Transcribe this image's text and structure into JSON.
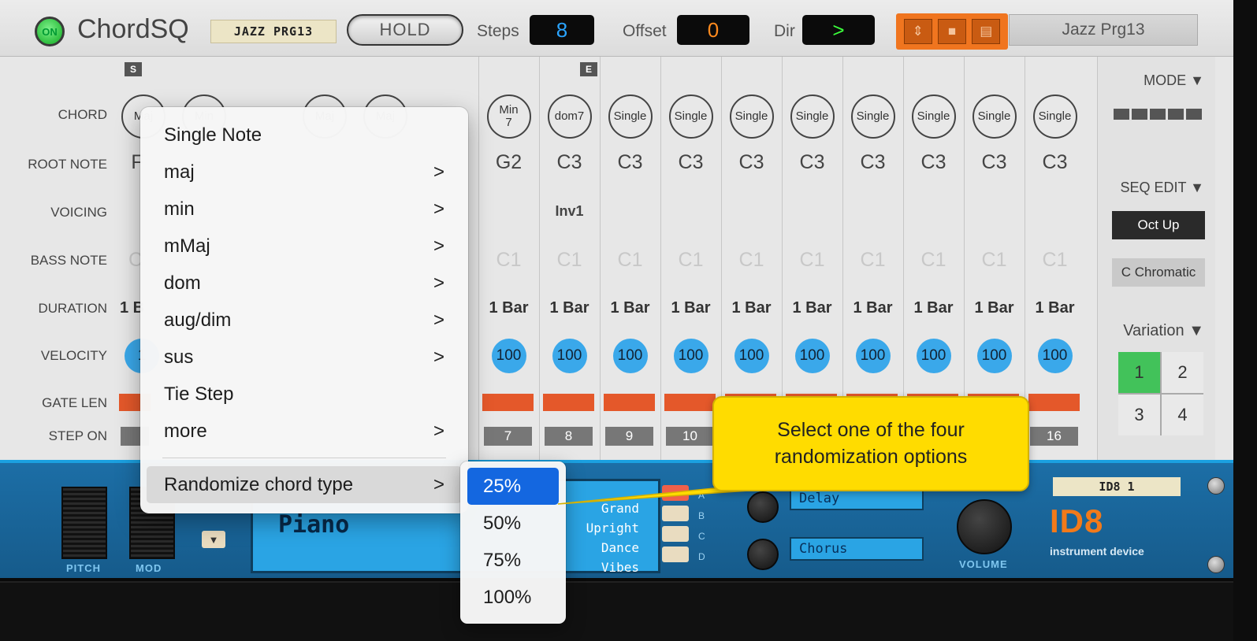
{
  "header": {
    "power_label": "ON",
    "title": "ChordSQ",
    "patch_tag": "JAZZ PRG13",
    "hold_label": "HOLD",
    "steps_label": "Steps",
    "steps_value": "8",
    "offset_label": "Offset",
    "offset_value": "0",
    "dir_label": "Dir",
    "dir_value": ">",
    "patch_name": "Jazz Prg13",
    "lcd_colors": {
      "steps": "#2aa4ff",
      "offset": "#ff8a1e",
      "dir": "#3cff3c"
    }
  },
  "markers": {
    "start": "S",
    "end": "E"
  },
  "row_labels": {
    "chord": "CHORD",
    "root": "ROOT NOTE",
    "voicing": "VOICING",
    "bass": "BASS NOTE",
    "duration": "DURATION",
    "velocity": "VELOCITY",
    "gate": "GATE LEN",
    "step_on": "STEP ON"
  },
  "partial": {
    "chord": [
      "Maj",
      "Min",
      "Maj",
      "Maj"
    ],
    "root_first": "F",
    "bass_first": "C",
    "duration_first": "1 B",
    "velocity_first": "1"
  },
  "steps": [
    {
      "chord": "Min\n7",
      "root": "G2",
      "voicing": "",
      "bass": "C1",
      "duration": "1 Bar",
      "velocity": "100",
      "step": "7"
    },
    {
      "chord": "dom7",
      "root": "C3",
      "voicing": "Inv1",
      "bass": "C1",
      "duration": "1 Bar",
      "velocity": "100",
      "step": "8"
    },
    {
      "chord": "Single",
      "root": "C3",
      "voicing": "",
      "bass": "C1",
      "duration": "1 Bar",
      "velocity": "100",
      "step": "9"
    },
    {
      "chord": "Single",
      "root": "C3",
      "voicing": "",
      "bass": "C1",
      "duration": "1 Bar",
      "velocity": "100",
      "step": "10"
    },
    {
      "chord": "Single",
      "root": "C3",
      "voicing": "",
      "bass": "C1",
      "duration": "1 Bar",
      "velocity": "100",
      "step": ""
    },
    {
      "chord": "Single",
      "root": "C3",
      "voicing": "",
      "bass": "C1",
      "duration": "1 Bar",
      "velocity": "100",
      "step": ""
    },
    {
      "chord": "Single",
      "root": "C3",
      "voicing": "",
      "bass": "C1",
      "duration": "1 Bar",
      "velocity": "100",
      "step": ""
    },
    {
      "chord": "Single",
      "root": "C3",
      "voicing": "",
      "bass": "C1",
      "duration": "1 Bar",
      "velocity": "100",
      "step": ""
    },
    {
      "chord": "Single",
      "root": "C3",
      "voicing": "",
      "bass": "C1",
      "duration": "1 Bar",
      "velocity": "100",
      "step": ""
    },
    {
      "chord": "Single",
      "root": "C3",
      "voicing": "",
      "bass": "C1",
      "duration": "1 Bar",
      "velocity": "100",
      "step": "16"
    }
  ],
  "right_panel": {
    "mode_label": "MODE ▼",
    "seq_edit_label": "SEQ EDIT ▼",
    "oct_up": "Oct Up",
    "scale": "C Chromatic",
    "variation_label": "Variation ▼",
    "variations": [
      "1",
      "2",
      "3",
      "4"
    ],
    "selected_variation": "1"
  },
  "menu": {
    "items": [
      {
        "label": "Single Note",
        "submenu": false
      },
      {
        "label": "maj",
        "submenu": true
      },
      {
        "label": "min",
        "submenu": true
      },
      {
        "label": "mMaj",
        "submenu": true
      },
      {
        "label": "dom",
        "submenu": true
      },
      {
        "label": "aug/dim",
        "submenu": true
      },
      {
        "label": "sus",
        "submenu": true
      },
      {
        "label": "Tie Step",
        "submenu": false
      },
      {
        "label": "more",
        "submenu": true
      }
    ],
    "randomize_label": "Randomize chord type",
    "chevron": ">",
    "submenu_items": [
      "25%",
      "50%",
      "75%",
      "100%"
    ],
    "submenu_selected": "25%"
  },
  "callout": {
    "text": "Select one of the four randomization options"
  },
  "device": {
    "pitch_label": "PITCH",
    "mod_label": "MOD",
    "instrument": "Piano",
    "instrument_options": [
      "Grand",
      "Upright",
      "Dance",
      "Vibes"
    ],
    "abcd": [
      "A",
      "B",
      "C",
      "D"
    ],
    "fx1": "Delay",
    "fx2": "Chorus",
    "volume_label": "VOLUME",
    "tag": "ID8 1",
    "logo": "ID8",
    "subtitle": "instrument device"
  }
}
